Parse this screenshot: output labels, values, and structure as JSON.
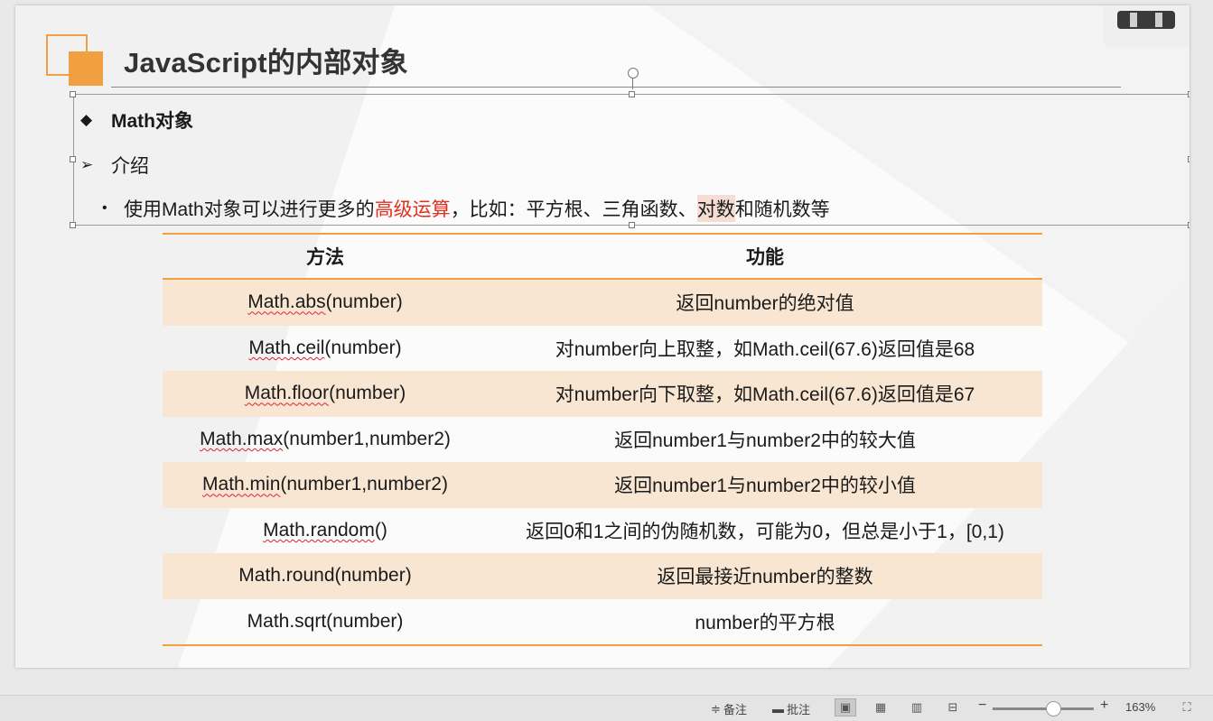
{
  "slide": {
    "title": "JavaScript的内部对象",
    "bullets": {
      "heading": "Math对象",
      "sub": "介绍",
      "text_pre": "使用Math对象可以进行更多的",
      "text_highlight": "高级运算",
      "text_mid": "，比如：平方根、三角函数、",
      "text_shaded": "对数",
      "text_post": "和随机数等"
    },
    "table": {
      "headers": [
        "方法",
        "功能"
      ],
      "rows": [
        {
          "method_pre": "",
          "method_squig": "Math.abs",
          "method_post": "(number)",
          "func": "返回number的绝对值",
          "shaded": true
        },
        {
          "method_pre": "",
          "method_squig": "Math.ceil",
          "method_post": "(number)",
          "func": "对number向上取整，如Math.ceil(67.6)返回值是68",
          "shaded": false
        },
        {
          "method_pre": "",
          "method_squig": "Math.floor",
          "method_post": "(number)",
          "func": "对number向下取整，如Math.ceil(67.6)返回值是67",
          "shaded": true
        },
        {
          "method_pre": "",
          "method_squig": "Math.max",
          "method_post": "(number1,number2)",
          "func": "返回number1与number2中的较大值",
          "shaded": false
        },
        {
          "method_pre": "",
          "method_squig": "Math.min",
          "method_post": "(number1,number2)",
          "func": "返回number1与number2中的较小值",
          "shaded": true
        },
        {
          "method_pre": "",
          "method_squig": "Math.random",
          "method_post": "()",
          "func": "返回0和1之间的伪随机数，可能为0，但总是小于1，[0,1)",
          "shaded": false
        },
        {
          "method_pre": "",
          "method_squig": "",
          "method_post": "Math.round(number)",
          "func": "返回最接近number的整数",
          "shaded": true
        },
        {
          "method_pre": "",
          "method_squig": "",
          "method_post": "Math.sqrt(number)",
          "func": "number的平方根",
          "shaded": false
        }
      ]
    }
  },
  "statusbar": {
    "notes_label": "备注",
    "comments_label": "批注",
    "zoom_minus": "−",
    "zoom_plus": "+",
    "zoom_level": "163%",
    "zoom_fraction": 0.6
  },
  "colors": {
    "accent": "#f0a040",
    "highlight_text": "#e03020",
    "row_shade": "#f8e6d2"
  }
}
